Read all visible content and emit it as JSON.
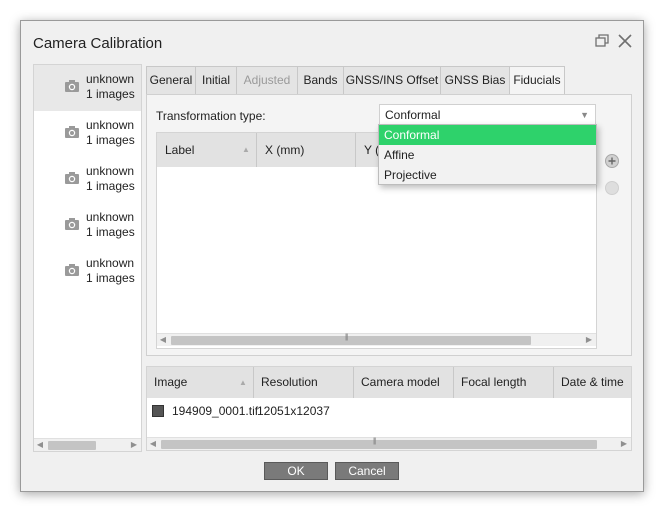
{
  "dialog": {
    "title": "Camera Calibration"
  },
  "cameras": [
    {
      "name": "unknown",
      "count": "1 images"
    },
    {
      "name": "unknown",
      "count": "1 images"
    },
    {
      "name": "unknown",
      "count": "1 images"
    },
    {
      "name": "unknown",
      "count": "1 images"
    },
    {
      "name": "unknown",
      "count": "1 images"
    }
  ],
  "tabs": [
    {
      "label": "General",
      "state": "normal"
    },
    {
      "label": "Initial",
      "state": "normal"
    },
    {
      "label": "Adjusted",
      "state": "disabled"
    },
    {
      "label": "Bands",
      "state": "normal"
    },
    {
      "label": "GNSS/INS Offset",
      "state": "normal"
    },
    {
      "label": "GNSS Bias",
      "state": "normal"
    },
    {
      "label": "Fiducials",
      "state": "active"
    }
  ],
  "fiducials": {
    "transformation_label": "Transformation type:",
    "transformation_value": "Conformal",
    "options": [
      "Conformal",
      "Affine",
      "Projective"
    ],
    "highlighted_option": "Conformal",
    "columns": [
      "Label",
      "X (mm)",
      "Y ("
    ]
  },
  "images": {
    "columns": [
      "Image",
      "Resolution",
      "Camera model",
      "Focal length",
      "Date & time"
    ],
    "rows": [
      {
        "image": "194909_0001.tif",
        "resolution": "12051x12037"
      }
    ]
  },
  "buttons": {
    "ok": "OK",
    "cancel": "Cancel"
  },
  "colors": {
    "highlight": "#2ed26b",
    "button": "#7a7a7a"
  },
  "icons": {
    "restore": "restore-icon",
    "close": "close-icon",
    "camera": "camera-icon",
    "add": "plus-circle-icon",
    "remove": "minus-circle-icon",
    "dropdown": "chevron-down-icon"
  }
}
